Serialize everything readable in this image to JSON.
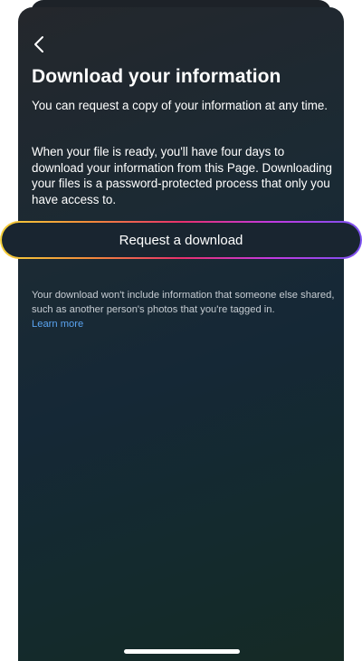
{
  "header": {
    "back_icon": "chevron-left-icon",
    "title": "Download your information"
  },
  "body": {
    "paragraph_1": "You can request a copy of your information at any time.",
    "paragraph_2": "When your file is ready, you'll have four days to download your information from this Page. Downloading your files is a password-protected process that only you have access to."
  },
  "actions": {
    "request_label": "Request a download"
  },
  "footer_note": {
    "text": "Your download won't include information that someone else shared, such as another person's photos that you're tagged in.",
    "link_label": "Learn more"
  },
  "colors": {
    "background": "#192530",
    "text": "#ffffff",
    "muted_text": "#c6ccd2",
    "link": "#5aa3f0",
    "gradient": [
      "#f4d03a",
      "#f28a3a",
      "#e8306c",
      "#c13ae0",
      "#7b52f0"
    ]
  }
}
